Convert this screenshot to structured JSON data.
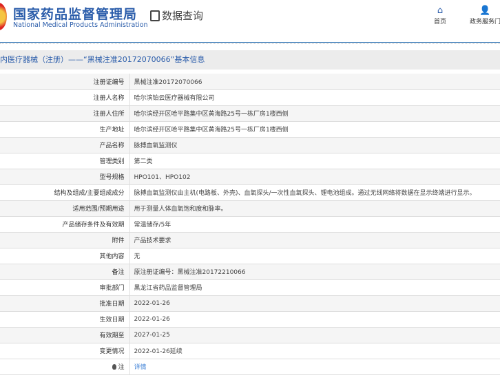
{
  "header": {
    "logo_cn": "国家药品监督管理局",
    "logo_en": "National Medical Products Administration",
    "section": "数据查询",
    "nav": [
      {
        "label": "首页",
        "icon": "home-icon"
      },
      {
        "label": "政务服务门",
        "icon": "user-icon"
      }
    ]
  },
  "title": "内医疗器械（注册）——“黑械注准20172070066”基本信息",
  "rows": [
    {
      "label": "注册证编号",
      "value": "黑械注准20172070066"
    },
    {
      "label": "注册人名称",
      "value": "哈尔滨铂云医疗器械有限公司"
    },
    {
      "label": "注册人住所",
      "value": "哈尔滨经开区哈平路集中区黄海路25号一栋厂房1楼西侧"
    },
    {
      "label": "生产地址",
      "value": "哈尔滨经开区哈平路集中区黄海路25号一栋厂房1楼西侧"
    },
    {
      "label": "产品名称",
      "value": "脉搏血氧监测仪"
    },
    {
      "label": "管理类别",
      "value": "第二类"
    },
    {
      "label": "型号规格",
      "value": "HPO101、HPO102"
    },
    {
      "label": "结构及组成/主要组成成分",
      "value": "脉搏血氧监测仪由主机(电路板、外壳)、血氧探头/一次性血氧探头、锂电池组成。通过无线网络将数据在显示终端进行显示。"
    },
    {
      "label": "适用范围/预期用途",
      "value": "用于测量人体血氧饱和度和脉率。"
    },
    {
      "label": "产品储存条件及有效期",
      "value": "常温储存/5年"
    },
    {
      "label": "附件",
      "value": "产品技术要求"
    },
    {
      "label": "其他内容",
      "value": "无"
    },
    {
      "label": "备注",
      "value": "原注册证编号：黑械注准20172210066"
    },
    {
      "label": "审批部门",
      "value": "黑龙江省药品监督管理局"
    },
    {
      "label": "批准日期",
      "value": "2022-01-26"
    },
    {
      "label": "生效日期",
      "value": "2022-01-26"
    },
    {
      "label": "有效期至",
      "value": "2027-01-25"
    },
    {
      "label": "变更情况",
      "value": "2022-01-26延续"
    }
  ],
  "note": {
    "label": "注",
    "link": "详情"
  }
}
